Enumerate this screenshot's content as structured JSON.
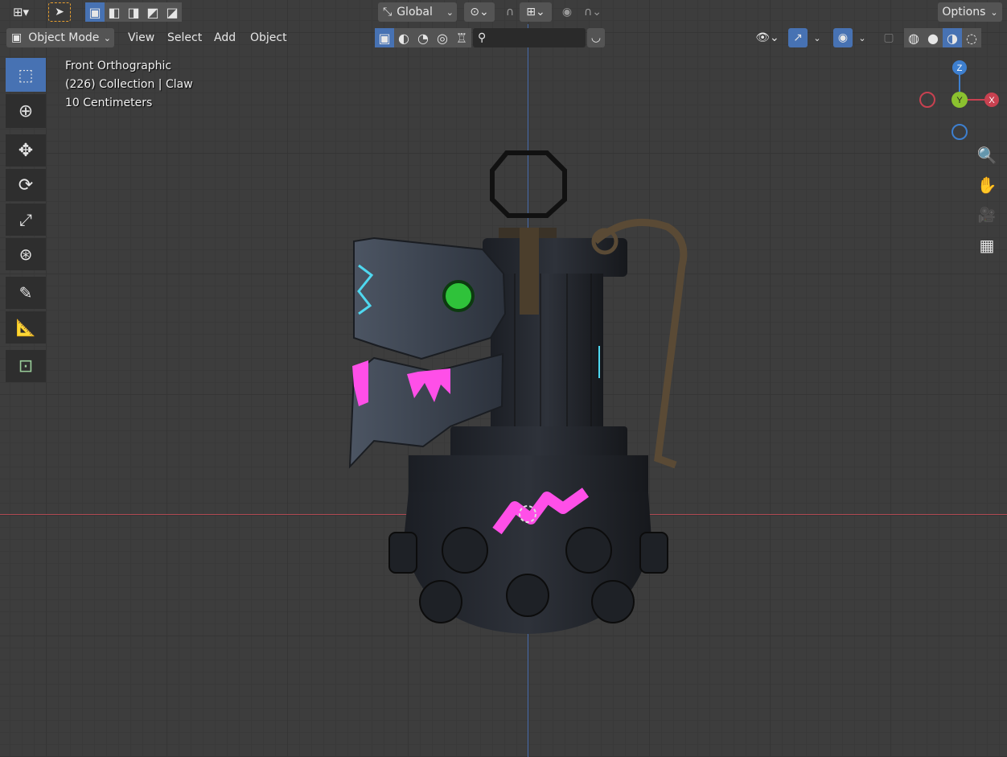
{
  "header": {
    "transform_orientation": "Global",
    "options_label": "Options"
  },
  "menubar": {
    "mode": "Object Mode",
    "items": [
      "View",
      "Select",
      "Add",
      "Object"
    ]
  },
  "viewport": {
    "view_name": "Front Orthographic",
    "collection_info": "(226) Collection | Claw",
    "scale_info": "10 Centimeters"
  },
  "gizmo": {
    "z_label": "Z",
    "y_label": "Y",
    "x_label": "X",
    "colors": {
      "x": "#c84150",
      "y": "#8bc12f",
      "z": "#3d7fcf"
    }
  },
  "colors": {
    "accent": "#4772b3",
    "neon_pink": "#ff4fe8",
    "neon_cyan": "#4fd8f0",
    "eye_green": "#2fc23a"
  }
}
